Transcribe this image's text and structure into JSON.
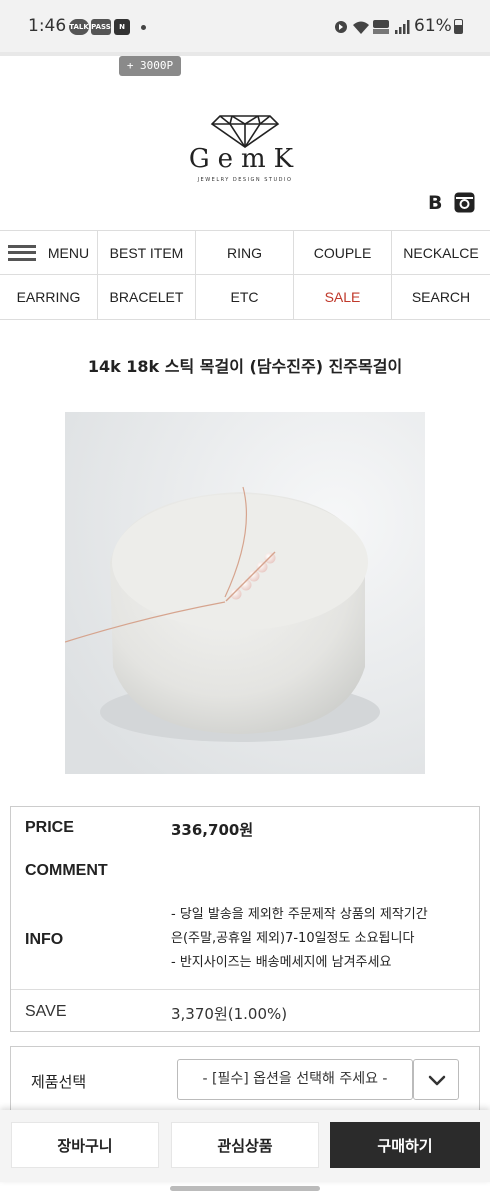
{
  "status_bar": {
    "time": "1:46",
    "left_icons": [
      "TALK",
      "PASS",
      "N"
    ],
    "battery_percent": "61%"
  },
  "points_badge": "+ 3000P",
  "brand": {
    "name": "GemK",
    "tagline": "JEWELRY DESIGN STUDIO"
  },
  "social": {
    "blog_label": "B"
  },
  "nav": {
    "menu_label": "MENU",
    "items_row1": [
      "BEST ITEM",
      "RING",
      "COUPLE",
      "NECKALCE"
    ],
    "items_row2": [
      "EARRING",
      "BRACELET",
      "ETC",
      "SALE",
      "SEARCH"
    ],
    "sale_color": "#c0392b"
  },
  "product": {
    "title": "14k 18k 스틱 목걸이 (담수진주) 진주목걸이",
    "price_label": "PRICE",
    "price_value": "336,700원",
    "comment_label": "COMMENT",
    "info_label": "INFO",
    "info_lines": [
      "- 당일 발송을 제외한 주문제작 상품의 제작기간",
      "은(주말,공휴일 제외)7-10일정도 소요됩니다",
      "- 반지사이즈는 배송메세지에 남겨주세요"
    ],
    "save_label": "SAVE",
    "save_value": "3,370원(1.00%)"
  },
  "options": {
    "label": "제품선택",
    "select_value": "- [필수] 옵션을 선택해 주세요 -"
  },
  "actions": {
    "cart": "장바구니",
    "wishlist": "관심상품",
    "buy": "구매하기",
    "buy_color": "#2b2b2b"
  }
}
